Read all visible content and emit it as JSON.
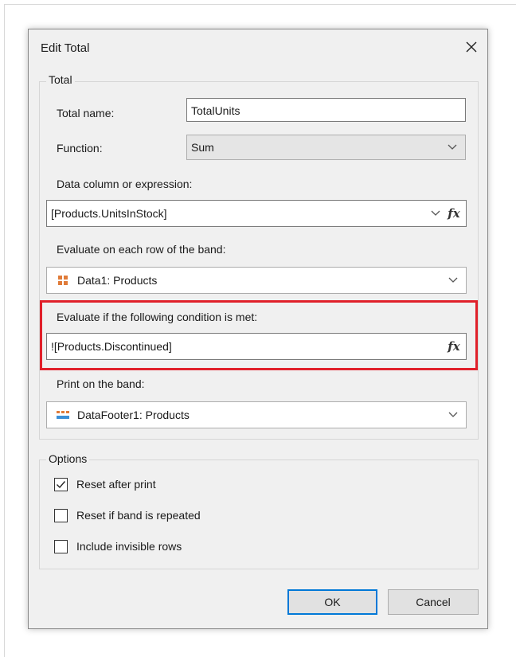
{
  "dialog": {
    "title": "Edit Total"
  },
  "total_group": {
    "legend": "Total",
    "total_name_label": "Total name:",
    "total_name_value": "TotalUnits",
    "function_label": "Function:",
    "function_value": "Sum",
    "data_column_label": "Data column or expression:",
    "data_column_value": "[Products.UnitsInStock]",
    "evaluate_band_label": "Evaluate on each row of the band:",
    "evaluate_band_value": "Data1: Products",
    "condition_label": "Evaluate if the following condition is met:",
    "condition_value": "![Products.Discontinued]",
    "print_band_label": "Print on the band:",
    "print_band_value": "DataFooter1: Products"
  },
  "options_group": {
    "legend": "Options",
    "items": [
      {
        "label": "Reset after print",
        "checked": true
      },
      {
        "label": "Reset if band is repeated",
        "checked": false
      },
      {
        "label": "Include invisible rows",
        "checked": false
      }
    ]
  },
  "buttons": {
    "ok": "OK",
    "cancel": "Cancel"
  },
  "colors": {
    "highlight": "#e0202a",
    "primary_border": "#0078d7",
    "data_band_icon": "#e07b39",
    "footer_band_icon": "#3c8fd6"
  },
  "icons": {
    "close": "close-icon",
    "chevron": "chevron-down-icon",
    "expression": "fx-icon",
    "data_band": "data-band-icon",
    "footer_band": "data-footer-band-icon",
    "check": "checkmark-icon"
  }
}
